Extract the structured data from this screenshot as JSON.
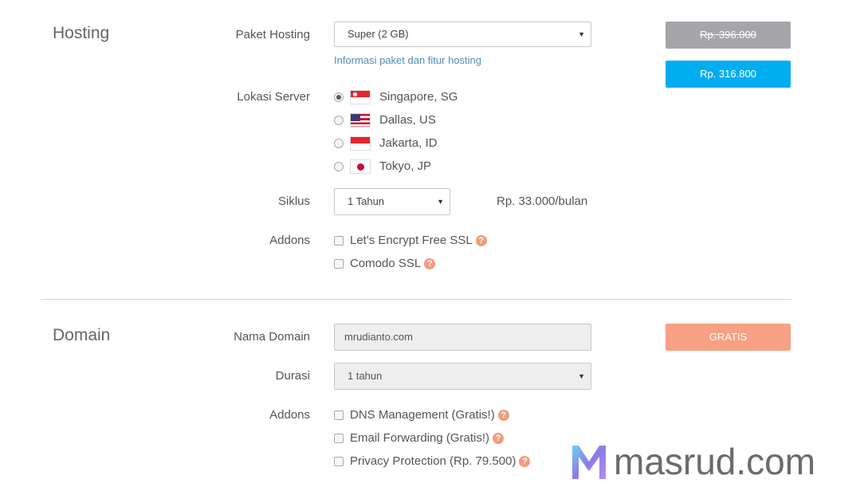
{
  "hosting": {
    "title": "Hosting",
    "package": {
      "label": "Paket Hosting",
      "value": "Super (2 GB)",
      "info_link": "Informasi paket dan fitur hosting"
    },
    "price_old": "Rp. 396.000",
    "price_new": "Rp. 316.800",
    "server": {
      "label": "Lokasi Server",
      "options": [
        {
          "name": "Singapore, SG",
          "selected": true,
          "flag": "sg-flag-icon"
        },
        {
          "name": "Dallas, US",
          "selected": false,
          "flag": "us-flag-icon"
        },
        {
          "name": "Jakarta, ID",
          "selected": false,
          "flag": "id-flag-icon"
        },
        {
          "name": "Tokyo, JP",
          "selected": false,
          "flag": "jp-flag-icon"
        }
      ]
    },
    "cycle": {
      "label": "Siklus",
      "value": "1 Tahun",
      "per_month": "Rp. 33.000/bulan"
    },
    "addons": {
      "label": "Addons",
      "items": [
        {
          "name": "Let's Encrypt Free SSL",
          "checked": false
        },
        {
          "name": "Comodo SSL",
          "checked": false
        }
      ]
    }
  },
  "domain": {
    "title": "Domain",
    "name": {
      "label": "Nama Domain",
      "value": "mrudianto.com"
    },
    "price": "GRATIS",
    "duration": {
      "label": "Durasi",
      "value": "1 tahun"
    },
    "addons": {
      "label": "Addons",
      "items": [
        {
          "name": "DNS Management (Gratis!)",
          "checked": false
        },
        {
          "name": "Email Forwarding (Gratis!)",
          "checked": false
        },
        {
          "name": "Privacy Protection (Rp. 79.500)",
          "checked": false
        }
      ]
    }
  },
  "watermark": {
    "text": "masrud.com"
  },
  "colors": {
    "accent_blue": "#00aef0",
    "price_old_bg": "#a6a6aa",
    "gratis_bg": "#f7a083",
    "help_icon": "#f39c7b",
    "link": "#4f8fb8"
  }
}
